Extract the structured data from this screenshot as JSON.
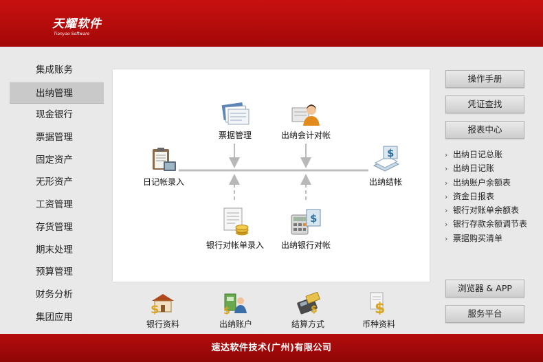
{
  "brand": {
    "name": "天耀软件",
    "sub": "Tianyao Software"
  },
  "sidebar": {
    "items": [
      {
        "label": "集成账务"
      },
      {
        "label": "出纳管理",
        "active": true
      },
      {
        "label": "现金银行"
      },
      {
        "label": "票据管理"
      },
      {
        "label": "固定资产"
      },
      {
        "label": "无形资产"
      },
      {
        "label": "工资管理"
      },
      {
        "label": "存货管理"
      },
      {
        "label": "期末处理"
      },
      {
        "label": "预算管理"
      },
      {
        "label": "财务分析"
      },
      {
        "label": "集团应用"
      }
    ]
  },
  "flow": {
    "journal_entry": "日记帐录入",
    "bill_management": "票据管理",
    "cashier_reconcile": "出纳会计对帐",
    "bank_statement_entry": "银行对帐单录入",
    "cashier_bank_reconcile": "出纳银行对帐",
    "cashier_close": "出纳结帐"
  },
  "bottom": {
    "bank_info": "银行资料",
    "cashier_account": "出纳账户",
    "settlement": "结算方式",
    "currency": "币种资料"
  },
  "right": {
    "manual": "操作手册",
    "voucher_search": "凭证查找",
    "report_center": "报表中心",
    "reports": [
      "出纳日记总账",
      "出纳日记账",
      "出纳账户余额表",
      "资金日报表",
      "银行对账单余额表",
      "银行存款余额调节表",
      "票据购买清单"
    ],
    "browser_app": "浏览器 & APP",
    "service_platform": "服务平台"
  },
  "footer": {
    "company": "速达软件技术(广州)有限公司"
  }
}
